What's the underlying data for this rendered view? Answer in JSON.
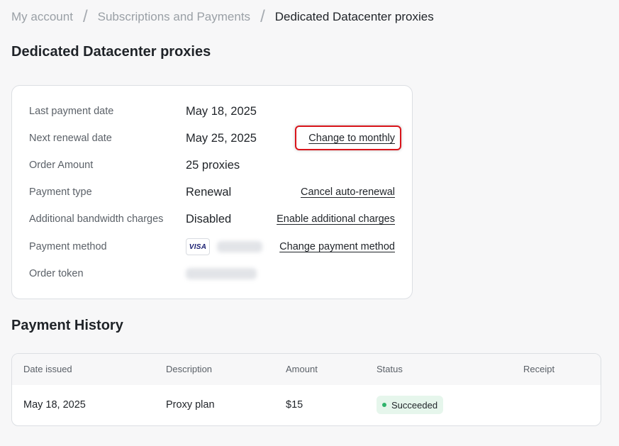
{
  "breadcrumb": {
    "items": [
      "My account",
      "Subscriptions and Payments",
      "Dedicated Datacenter proxies"
    ],
    "separator": "/"
  },
  "page_title": "Dedicated Datacenter proxies",
  "details": {
    "last_payment": {
      "label": "Last payment date",
      "value": "May 18, 2025"
    },
    "next_renewal": {
      "label": "Next renewal date",
      "value": "May 25, 2025",
      "action": "Change to monthly"
    },
    "order_amount": {
      "label": "Order Amount",
      "value": "25 proxies"
    },
    "payment_type": {
      "label": "Payment type",
      "value": "Renewal",
      "action": "Cancel auto-renewal"
    },
    "bandwidth": {
      "label": "Additional bandwidth charges",
      "value": "Disabled",
      "action": "Enable additional charges"
    },
    "payment_method": {
      "label": "Payment method",
      "card_brand": "VISA",
      "action": "Change payment method"
    },
    "order_token": {
      "label": "Order token"
    }
  },
  "history": {
    "title": "Payment History",
    "columns": [
      "Date issued",
      "Description",
      "Amount",
      "Status",
      "Receipt"
    ],
    "rows": [
      {
        "date": "May 18, 2025",
        "description": "Proxy plan",
        "amount": "$15",
        "status": "Succeeded"
      }
    ]
  },
  "colors": {
    "highlight": "#d9141b",
    "success_bg": "#e6f6ec",
    "success_dot": "#2fb36b",
    "visa": "#1a1f71"
  }
}
